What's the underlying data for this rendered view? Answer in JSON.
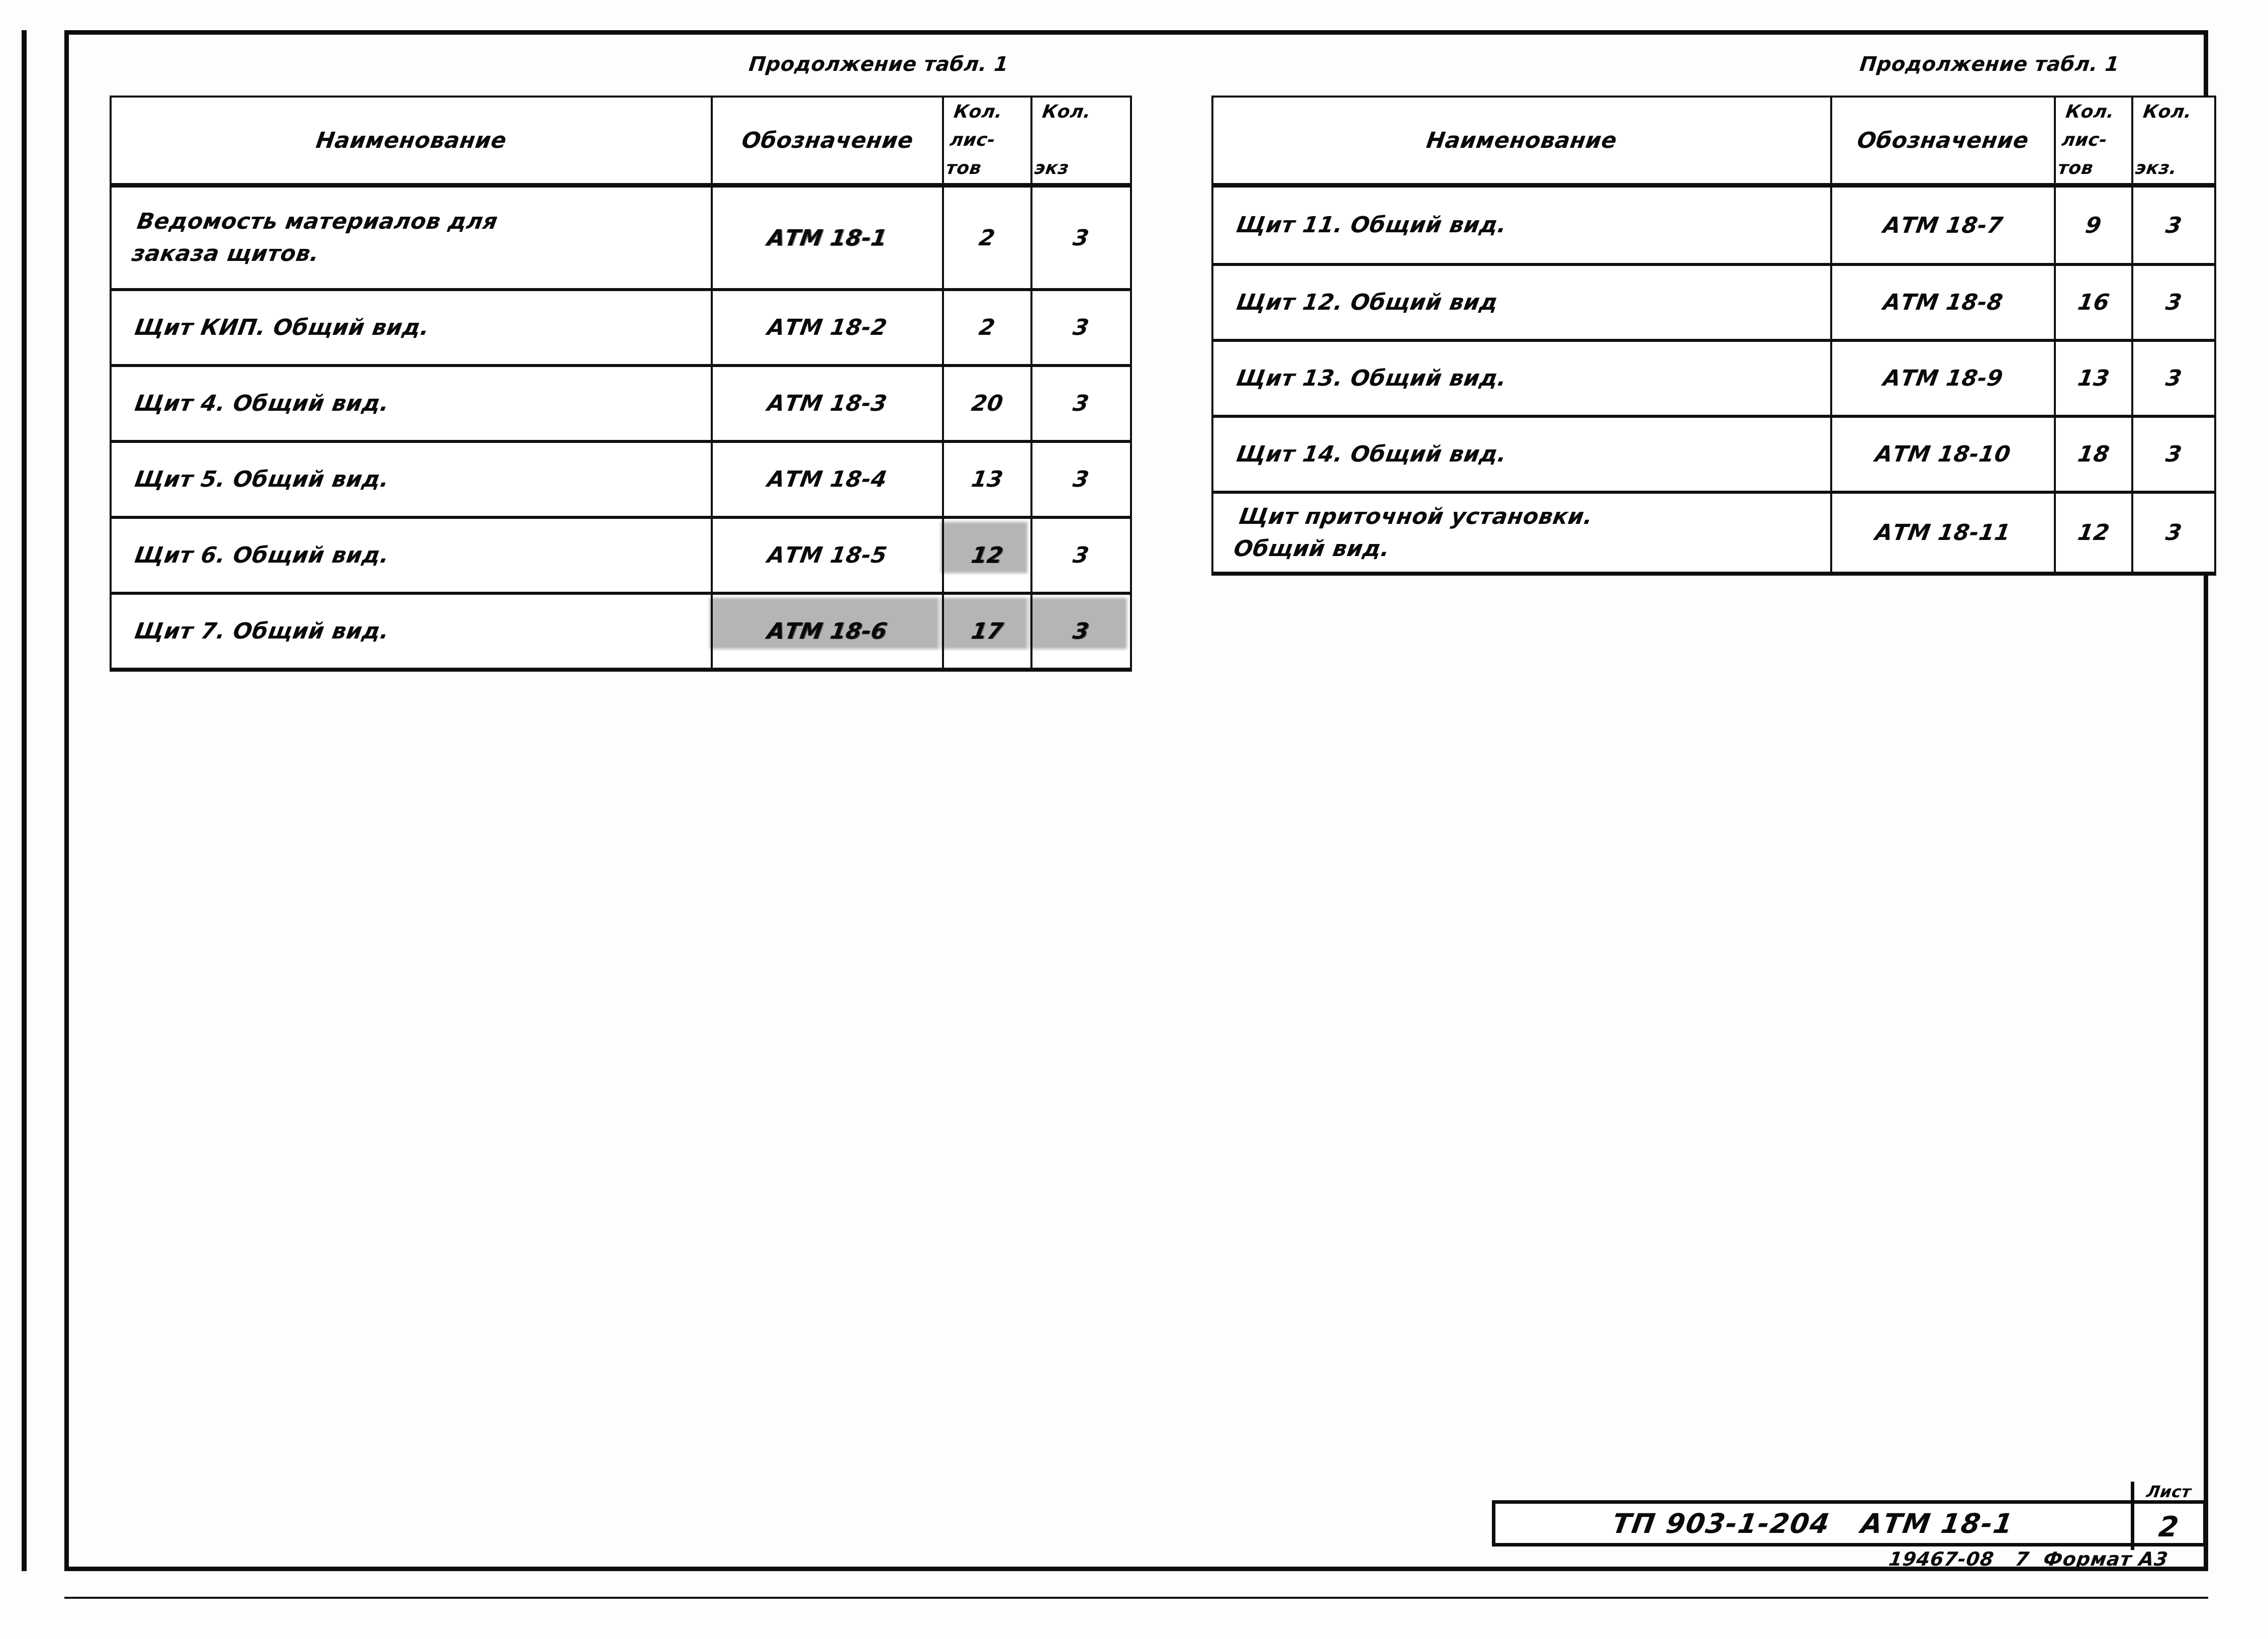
{
  "document": {
    "left_table_caption": "Продолжение табл. 1",
    "right_table_caption": "Продолжение табл. 1"
  },
  "table_headers": {
    "name": "Наименование",
    "designation": "Обозначение",
    "sheets_count": "Кол.\nлис-\nтов",
    "copies_count": "Кол.\n\nэкз"
  },
  "table_headers_right": {
    "name": "Наименование",
    "designation": "Обозначение",
    "sheets_count": "Кол.\nлис-\nтов",
    "copies_count": "Кол.\n\nэкз."
  },
  "left_table": {
    "rows": [
      {
        "name": "Ведомость  материалов  для\nзаказа    щитов.",
        "designation": "АТМ 18-1",
        "sheets": "2",
        "copies": "3"
      },
      {
        "name": "Щит  КИП.  Общий  вид.",
        "designation": "АТМ 18-2",
        "sheets": "2",
        "copies": "3"
      },
      {
        "name": "Щит 4.   Общий  вид.",
        "designation": "АТМ 18-3",
        "sheets": "20",
        "copies": "3"
      },
      {
        "name": "Щит 5.   Общий  вид.",
        "designation": "АТМ 18-4",
        "sheets": "13",
        "copies": "3"
      },
      {
        "name": "Щит 6.   Общий  вид.",
        "designation": "АТМ 18-5",
        "sheets": "12",
        "copies": "3"
      },
      {
        "name": "Щит 7.  Общий  вид.",
        "designation": "АТМ 18-6",
        "sheets": "17",
        "copies": "3"
      }
    ]
  },
  "right_table": {
    "rows": [
      {
        "name": "Щит 11.  Общий  вид.",
        "designation": "АТМ 18-7",
        "sheets": "9",
        "copies": "3"
      },
      {
        "name": "Щит 12.  Общий  вид",
        "designation": "АТМ 18-8",
        "sheets": "16",
        "copies": "3"
      },
      {
        "name": "Щит 13.  Общий  вид.",
        "designation": "АТМ 18-9",
        "sheets": "13",
        "copies": "3"
      },
      {
        "name": "Щит 14.  Общий  вид.",
        "designation": "АТМ 18-10",
        "sheets": "18",
        "copies": "3"
      },
      {
        "name": "Щит  приточной  установки.\nОбщий  вид.",
        "designation": "АТМ 18-11",
        "sheets": "12",
        "copies": "3"
      }
    ]
  },
  "title_block": {
    "designation": "ТП 903-1-204   АТМ 18-1",
    "sheet_label": "Лист",
    "sheet_number": "2"
  },
  "footer": {
    "text": "19467-08   7  Формат А3"
  }
}
